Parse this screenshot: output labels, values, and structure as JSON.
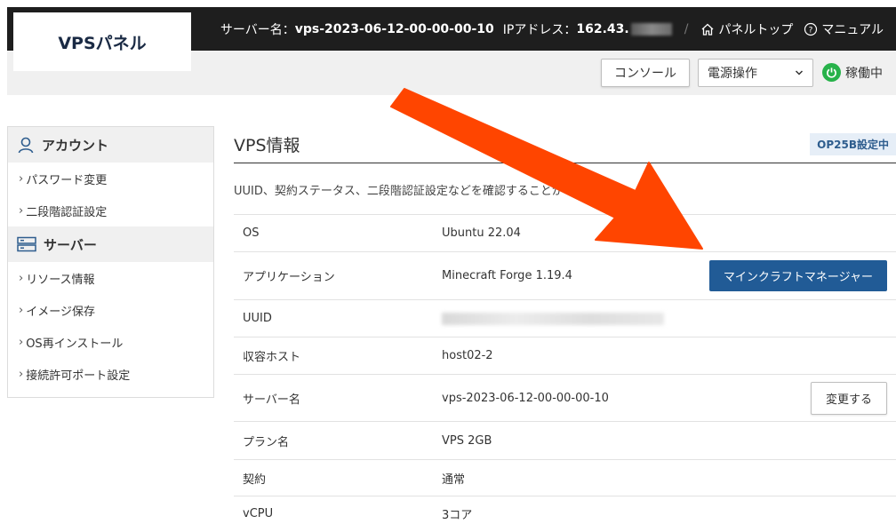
{
  "logo": "VPSパネル",
  "top": {
    "server_label": "サーバー名：",
    "server_name": "vps-2023-06-12-00-00-00-10",
    "ip_label": "IPアドレス：",
    "ip_value": "162.43.",
    "separator": "/",
    "panel_top": "パネルトップ",
    "manual": "マニュアル"
  },
  "controls": {
    "console": "コンソール",
    "power": "電源操作",
    "status": "稼働中",
    "status_color": "#27b24a"
  },
  "sidebar": {
    "sections": [
      {
        "title": "アカウント",
        "icon": "person-icon",
        "items": [
          "パスワード変更",
          "二段階認証設定"
        ]
      },
      {
        "title": "サーバー",
        "icon": "server-icon",
        "items": [
          "リソース情報",
          "イメージ保存",
          "OS再インストール",
          "接続許可ポート設定"
        ]
      }
    ]
  },
  "main": {
    "title": "VPS情報",
    "badge": "OP25B設定中",
    "description": "UUID、契約ステータス、二段階認証設定などを確認することができます。",
    "rows": [
      {
        "key": "OS",
        "value": "Ubuntu 22.04"
      },
      {
        "key": "アプリケーション",
        "value": "Minecraft Forge 1.19.4",
        "action": "マインクラフトマネージャー"
      },
      {
        "key": "UUID",
        "value": ""
      },
      {
        "key": "収容ホスト",
        "value": "host02-2"
      },
      {
        "key": "サーバー名",
        "value": "vps-2023-06-12-00-00-00-10",
        "action": "変更する"
      },
      {
        "key": "プラン名",
        "value": "VPS 2GB"
      },
      {
        "key": "契約",
        "value": "通常"
      },
      {
        "key": "vCPU",
        "value": "3コア"
      }
    ]
  },
  "colors": {
    "accent": "#215b96",
    "arrow": "#ff4500",
    "topbar": "#1e1e1e"
  }
}
